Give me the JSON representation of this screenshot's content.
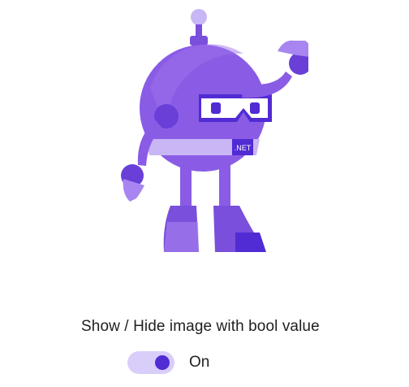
{
  "image": {
    "icon": "dotnet-bot-icon",
    "badge_text": ".NET",
    "visible": true
  },
  "caption": "Show / Hide image with bool value",
  "toggle": {
    "state_label": "On",
    "is_on": true,
    "track_color": "#d9cdfa",
    "thumb_color": "#512bd4"
  },
  "colors": {
    "bot_primary": "#8a5ce6",
    "bot_dark": "#512bd4",
    "bot_light": "#c9b6f5"
  }
}
